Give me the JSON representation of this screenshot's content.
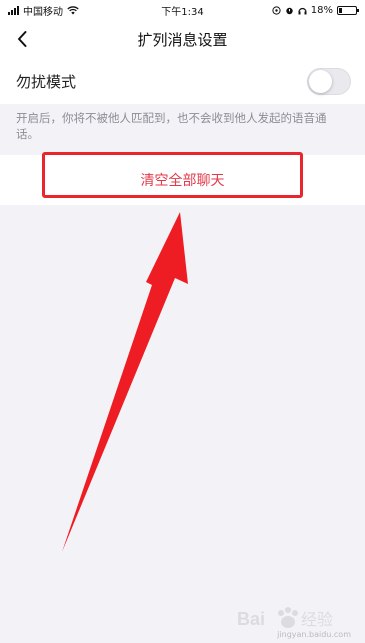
{
  "status_bar": {
    "carrier": "中国移动",
    "time": "下午1:34",
    "battery": "18%"
  },
  "nav": {
    "title": "扩列消息设置"
  },
  "settings": {
    "do_not_disturb_label": "勿扰模式",
    "do_not_disturb_on": false,
    "hint": "开启后，你将不被他人匹配到，也不会收到他人发起的语音通话。",
    "clear_all_label": "清空全部聊天"
  },
  "watermark": {
    "logo_text": "Bai 经验",
    "url": "jingyan.baidu.com"
  },
  "colors": {
    "accent_red": "#e23a4a",
    "highlight_red": "#e8262b",
    "background": "#f3f3f7"
  }
}
